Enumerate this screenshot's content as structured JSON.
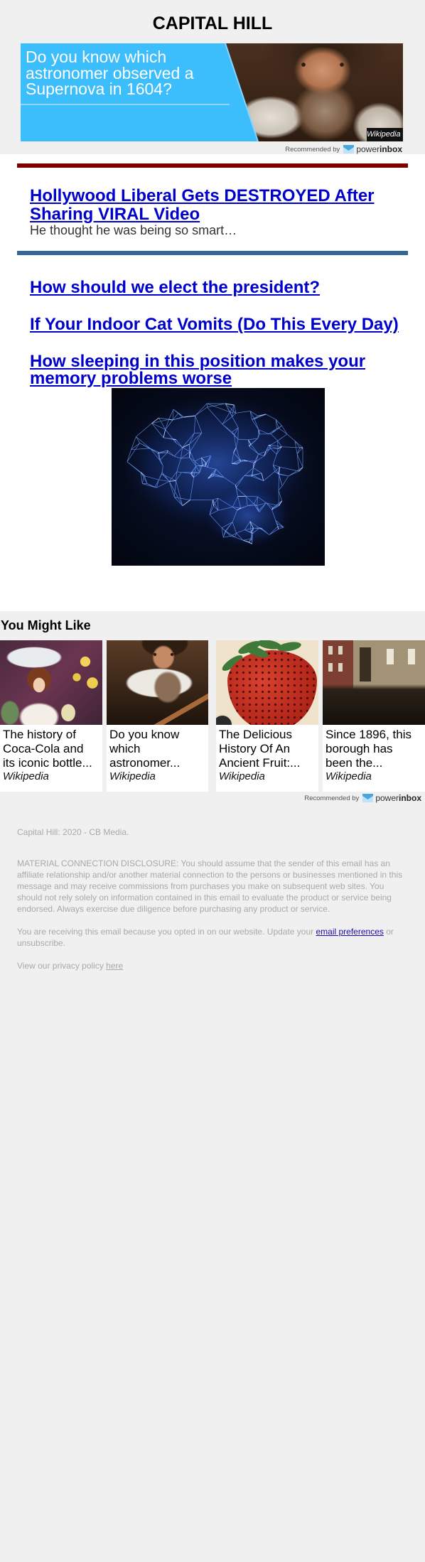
{
  "header": {
    "title": "CAPITAL HILL"
  },
  "banner": {
    "headline": "Do you know which astronomer observed a Supernova in 1604?",
    "image": "astronomer-portrait",
    "source_label": "Wikipedia",
    "recommended_by": "Recommended by",
    "brand": {
      "part1": "power",
      "part2": "inbox",
      "icon": "powerinbox-logo-icon"
    }
  },
  "featured": {
    "title": "Hollywood Liberal Gets DESTROYED After Sharing VIRAL Video",
    "subtitle": "He thought he was being so smart…"
  },
  "stories": [
    {
      "title": "How should we elect the president?"
    },
    {
      "title": "If Your Indoor Cat Vomits (Do This Every Day)"
    },
    {
      "title": "How sleeping in this position makes your memory problems worse",
      "image": "glowing-brain-network"
    }
  ],
  "you_might_like": {
    "heading": "You Might Like",
    "cards": [
      {
        "title": "The history of Coca-Cola and its iconic bottle...",
        "source": "Wikipedia",
        "image": "vintage-coca-cola-ad"
      },
      {
        "title": "Do you know which astronomer...",
        "source": "Wikipedia",
        "image": "astronomer-portrait"
      },
      {
        "title": "The Delicious History Of An Ancient Fruit:...",
        "source": "Wikipedia",
        "image": "strawberry-illustration"
      },
      {
        "title": "Since 1896, this borough has been the...",
        "source": "Wikipedia",
        "image": "city-street-scene"
      }
    ],
    "recommended_by": "Recommended by",
    "brand": {
      "part1": "power",
      "part2": "inbox",
      "icon": "powerinbox-logo-icon"
    }
  },
  "footer": {
    "copyright": "Capital Hill: 2020 - CB Media.",
    "disclosure": "MATERIAL CONNECTION DISCLOSURE: You should assume that the sender of this email has an affiliate relationship and/or another material connection to the persons or businesses mentioned in this message and may receive commissions from purchases you make on subsequent web sites. You should not rely solely on information contained in this email to evaluate the product or service being endorsed. Always exercise due diligence before purchasing any product or service.",
    "receiving": {
      "prefix": "You are receiving this email because you opted in on our website. Update your ",
      "link": "email preferences",
      "suffix": " or unsubscribe."
    },
    "privacy": {
      "prefix": "View our privacy policy ",
      "link": "here"
    }
  },
  "colors": {
    "page_background": "#f0f0f0",
    "red_divider": "#800000",
    "blue_divider": "#336699",
    "banner_blue": "#3cbdfc",
    "headline_link": "#0000cc",
    "footer_text": "#a9a9a9",
    "footer_link": "#1a0dab"
  }
}
